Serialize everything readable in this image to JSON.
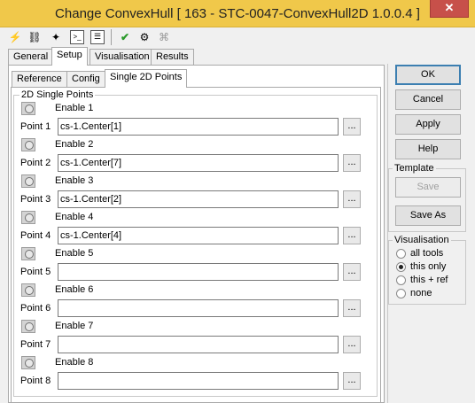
{
  "window": {
    "title": "Change ConvexHull [ 163 - STC-0047-ConvexHull2D 1.0.0.4 ]",
    "close_label": "✕"
  },
  "toolbar": {
    "icons": [
      "lightning-icon",
      "link-icon",
      "puzzle-icon",
      "terminal-icon",
      "list-icon",
      "checkmark-icon",
      "settings-icon",
      "network-icon"
    ]
  },
  "tabs": {
    "main": [
      "General",
      "Setup",
      "Visualisation",
      "Results"
    ],
    "main_selected": "Setup",
    "sub": [
      "Reference",
      "Config",
      "Single 2D Points"
    ],
    "sub_selected": "Single 2D Points"
  },
  "group": {
    "legend": "2D Single Points",
    "items": [
      {
        "enable_label": "Enable 1",
        "point_label": "Point 1",
        "value": "cs-1.Center[1]"
      },
      {
        "enable_label": "Enable 2",
        "point_label": "Point 2",
        "value": "cs-1.Center[7]"
      },
      {
        "enable_label": "Enable 3",
        "point_label": "Point 3",
        "value": "cs-1.Center[2]"
      },
      {
        "enable_label": "Enable 4",
        "point_label": "Point 4",
        "value": "cs-1.Center[4]"
      },
      {
        "enable_label": "Enable 5",
        "point_label": "Point 5",
        "value": ""
      },
      {
        "enable_label": "Enable 6",
        "point_label": "Point 6",
        "value": ""
      },
      {
        "enable_label": "Enable 7",
        "point_label": "Point 7",
        "value": ""
      },
      {
        "enable_label": "Enable 8",
        "point_label": "Point 8",
        "value": ""
      }
    ],
    "browse_label": "..."
  },
  "buttons": {
    "ok": "OK",
    "cancel": "Cancel",
    "apply": "Apply",
    "help": "Help"
  },
  "template": {
    "legend": "Template",
    "save": "Save",
    "save_as": "Save As"
  },
  "visualisation": {
    "legend": "Visualisation",
    "options": [
      "all tools",
      "this only",
      "this + ref",
      "none"
    ],
    "selected": "this only"
  }
}
